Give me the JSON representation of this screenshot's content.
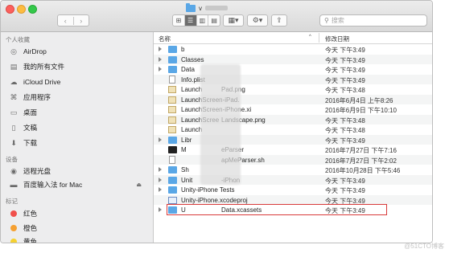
{
  "window": {
    "title": "v"
  },
  "toolbar": {
    "nav_back": "‹",
    "nav_forward": "›",
    "views": [
      "⊞",
      "☰",
      "▥",
      "▤"
    ],
    "arrange": "▦▾",
    "action": "⚙▾",
    "share": "⇪",
    "search_placeholder": "搜索"
  },
  "sidebar": {
    "favorites_heading": "个人收藏",
    "favorites": [
      {
        "label": "AirDrop",
        "icon": "airdrop-icon"
      },
      {
        "label": "我的所有文件",
        "icon": "all-files-icon"
      },
      {
        "label": "iCloud Drive",
        "icon": "cloud-icon"
      },
      {
        "label": "应用程序",
        "icon": "applications-icon"
      },
      {
        "label": "桌面",
        "icon": "desktop-icon"
      },
      {
        "label": "文稿",
        "icon": "documents-icon"
      },
      {
        "label": "下载",
        "icon": "downloads-icon"
      }
    ],
    "devices_heading": "设备",
    "devices": [
      {
        "label": "远程光盘",
        "icon": "disc-icon"
      },
      {
        "label": "百度输入法 for Mac",
        "icon": "drive-icon",
        "eject": "⏏"
      }
    ],
    "tags_heading": "标记",
    "tags": [
      {
        "label": "红色",
        "color": "#f0504b"
      },
      {
        "label": "橙色",
        "color": "#f5a031"
      },
      {
        "label": "黄色",
        "color": "#f5d130"
      }
    ]
  },
  "columns": {
    "name": "名称",
    "sort_indicator": "^",
    "date": "修改日期"
  },
  "files": [
    {
      "name": "b",
      "date": "今天 下午3:49",
      "kind": "folder",
      "expandable": true
    },
    {
      "name": "Classes",
      "date": "今天 下午3:49",
      "kind": "folder",
      "expandable": true
    },
    {
      "name": "Data",
      "date": "今天 下午3:49",
      "kind": "folder",
      "expandable": true
    },
    {
      "name": "Info.plist",
      "date": "今天 下午3:49",
      "kind": "doc",
      "expandable": false
    },
    {
      "name": "Launch",
      "suffix": "Pad.png",
      "date": "今天 下午3:48",
      "kind": "png",
      "expandable": false
    },
    {
      "name": "LaunchScreen-iPad.",
      "date": "2016年6月4日 上午8:26",
      "kind": "png",
      "expandable": false
    },
    {
      "name": "LaunchScreen-iPhone.xi",
      "date": "2016年6月9日 下午10:10",
      "kind": "png",
      "expandable": false
    },
    {
      "name": "LaunchScree",
      "suffix": "Landscape.png",
      "date": "今天 下午3:48",
      "kind": "png",
      "expandable": false
    },
    {
      "name": "Launch",
      "suffix": "",
      "date": "今天 下午3:48",
      "kind": "png",
      "expandable": false
    },
    {
      "name": "Libr",
      "date": "今天 下午3:49",
      "kind": "folder",
      "expandable": true
    },
    {
      "name": "M",
      "suffix": "eParser",
      "date": "2016年7月27日 下午7:16",
      "kind": "exec",
      "expandable": false
    },
    {
      "name": "",
      "suffix": "apMeParser.sh",
      "date": "2016年7月27日 下午2:02",
      "kind": "doc",
      "expandable": false
    },
    {
      "name": "Sh",
      "date": "2016年10月28日 下午5:46",
      "kind": "folder",
      "expandable": true
    },
    {
      "name": "Unit",
      "suffix": "-iPhon",
      "date": "今天 下午3:49",
      "kind": "folder",
      "expandable": true
    },
    {
      "name": "Unity-iPhone Tests",
      "date": "今天 下午3:49",
      "kind": "folder",
      "expandable": true
    },
    {
      "name": "Unity-iPhone.xcodeproj",
      "date": "今天 下午3:49",
      "kind": "xcode",
      "expandable": false,
      "highlighted": true
    },
    {
      "name": "U",
      "suffix": "Data.xcassets",
      "date": "今天 下午3:49",
      "kind": "folder",
      "expandable": true
    }
  ],
  "watermark": "@51CTO博客"
}
